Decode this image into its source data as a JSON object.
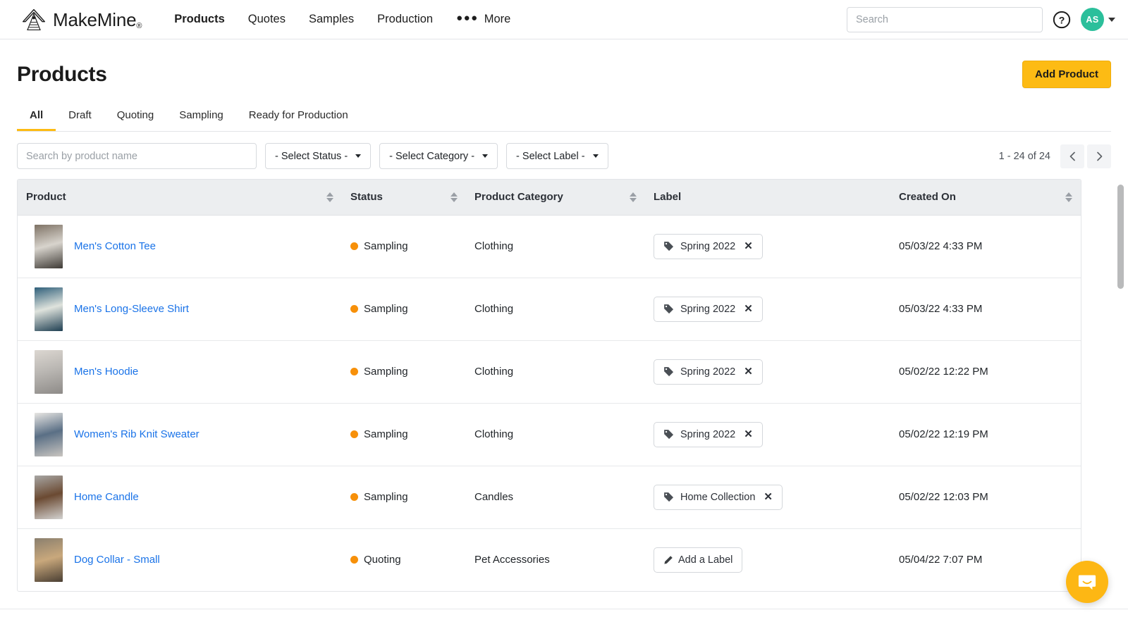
{
  "header": {
    "brand_name": "MakeMine",
    "brand_reg": "®",
    "nav": [
      {
        "label": "Products",
        "active": true
      },
      {
        "label": "Quotes",
        "active": false
      },
      {
        "label": "Samples",
        "active": false
      },
      {
        "label": "Production",
        "active": false
      },
      {
        "label": "More",
        "active": false
      }
    ],
    "search_placeholder": "Search",
    "search_value": "",
    "avatar_initials": "AS"
  },
  "page": {
    "title": "Products",
    "add_button": "Add Product"
  },
  "tabs": [
    {
      "label": "All",
      "active": true
    },
    {
      "label": "Draft",
      "active": false
    },
    {
      "label": "Quoting",
      "active": false
    },
    {
      "label": "Sampling",
      "active": false
    },
    {
      "label": "Ready for Production",
      "active": false
    }
  ],
  "filters": {
    "search_placeholder": "Search by product name",
    "search_value": "",
    "status_select": "- Select Status -",
    "category_select": "- Select Category -",
    "label_select": "- Select Label -"
  },
  "pagination": {
    "range_label": "1 - 24 of 24",
    "prev_icon": "chevron-left-icon",
    "next_icon": "chevron-right-icon"
  },
  "table": {
    "columns": [
      {
        "label": "Product",
        "sortable": true
      },
      {
        "label": "Status",
        "sortable": true
      },
      {
        "label": "Product Category",
        "sortable": true
      },
      {
        "label": "Label",
        "sortable": false
      },
      {
        "label": "Created On",
        "sortable": true
      }
    ],
    "rows": [
      {
        "product": "Men's Cotton Tee",
        "status": "Sampling",
        "status_color": "#f79009",
        "category": "Clothing",
        "label": "Spring 2022",
        "label_action": "remove",
        "created_on": "05/03/22 4:33 PM",
        "thumb_colors": [
          "#7e7265",
          "#d8d4cd",
          "#3e3a35"
        ]
      },
      {
        "product": "Men's Long-Sleeve Shirt",
        "status": "Sampling",
        "status_color": "#f79009",
        "category": "Clothing",
        "label": "Spring 2022",
        "label_action": "remove",
        "created_on": "05/03/22 4:33 PM",
        "thumb_colors": [
          "#2f5f7a",
          "#dfe3dd",
          "#1f3f52"
        ]
      },
      {
        "product": "Men's Hoodie",
        "status": "Sampling",
        "status_color": "#f79009",
        "category": "Clothing",
        "label": "Spring 2022",
        "label_action": "remove",
        "created_on": "05/02/22 12:22 PM",
        "thumb_colors": [
          "#dcd7d1",
          "#b9b6b2",
          "#8e8b88"
        ]
      },
      {
        "product": "Women's Rib Knit Sweater",
        "status": "Sampling",
        "status_color": "#f79009",
        "category": "Clothing",
        "label": "Spring 2022",
        "label_action": "remove",
        "created_on": "05/02/22 12:19 PM",
        "thumb_colors": [
          "#e8e6e3",
          "#5a6f85",
          "#c9c5c0"
        ]
      },
      {
        "product": "Home Candle",
        "status": "Sampling",
        "status_color": "#f79009",
        "category": "Candles",
        "label": "Home Collection",
        "label_action": "remove",
        "created_on": "05/02/22 12:03 PM",
        "thumb_colors": [
          "#a7a6a4",
          "#6b4a32",
          "#d3d2d0"
        ]
      },
      {
        "product": "Dog Collar - Small",
        "status": "Quoting",
        "status_color": "#f79009",
        "category": "Pet Accessories",
        "label": "Add a Label",
        "label_action": "add",
        "created_on": "05/04/22 7:07 PM",
        "thumb_colors": [
          "#8a7f6e",
          "#c9a87c",
          "#4a3f33"
        ]
      }
    ]
  },
  "chat": {
    "icon": "chat-bubble-icon",
    "color": "#fdb714"
  }
}
